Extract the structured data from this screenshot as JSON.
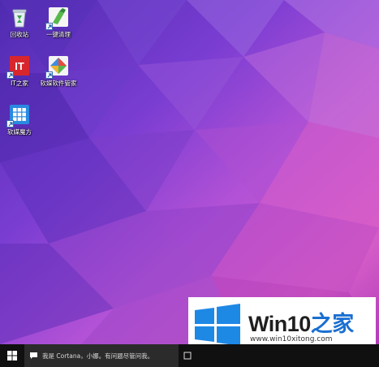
{
  "desktop": {
    "icons": [
      {
        "label": "回收站",
        "icon": "recycle-bin-icon"
      },
      {
        "label": "一键清理",
        "icon": "broom-cleaner-icon"
      },
      {
        "label": "IT之家",
        "icon": "ithome-icon"
      },
      {
        "label": "软媒软件管家",
        "icon": "software-manager-icon"
      },
      {
        "label": "软媒魔方",
        "icon": "rubiks-cube-icon"
      }
    ],
    "ithome_logo_text": "IT"
  },
  "taskbar": {
    "search_placeholder": "我是 Cortana，小娜。有问题尽管问我。",
    "start_icon": "windows-logo-icon",
    "taskview_icon": "task-view-icon"
  },
  "watermark": {
    "brand_main": "Win10",
    "brand_accent": "之家",
    "url": "www.win10xitong.com",
    "accent_color": "#1a6fd0",
    "logo_color": "#1e88e5"
  }
}
